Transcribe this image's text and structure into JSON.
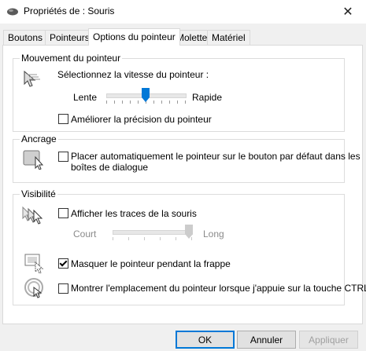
{
  "window": {
    "title": "Propriétés de : Souris",
    "close_glyph": "✕"
  },
  "tabs": [
    {
      "label": "Boutons",
      "active": false
    },
    {
      "label": "Pointeurs",
      "active": false
    },
    {
      "label": "Options du pointeur",
      "active": true
    },
    {
      "label": "Molette",
      "active": false
    },
    {
      "label": "Matériel",
      "active": false
    }
  ],
  "motion": {
    "title": "Mouvement du pointeur",
    "speed_label": "Sélectionnez la vitesse du pointeur :",
    "slow_label": "Lente",
    "fast_label": "Rapide",
    "speed_value": 0.5,
    "precision_label": "Améliorer la précision du pointeur",
    "precision_checked": false
  },
  "snap": {
    "title": "Ancrage",
    "line1": "Placer automatiquement le pointeur sur le bouton par défaut dans les",
    "line2": "boîtes de dialogue",
    "checked": false
  },
  "visibility": {
    "title": "Visibilité",
    "trails_label": "Afficher les traces de la souris",
    "trails_checked": false,
    "short_label": "Court",
    "long_label": "Long",
    "trails_length_value": 1.0,
    "hide_label": "Masquer le pointeur pendant la frappe",
    "hide_checked": true,
    "ctrl_label": "Montrer l'emplacement du pointeur lorsque j'appuie sur la touche CTRL",
    "ctrl_checked": false
  },
  "buttons": {
    "ok": "OK",
    "cancel": "Annuler",
    "apply": "Appliquer"
  },
  "colors": {
    "accent": "#0078d7"
  }
}
